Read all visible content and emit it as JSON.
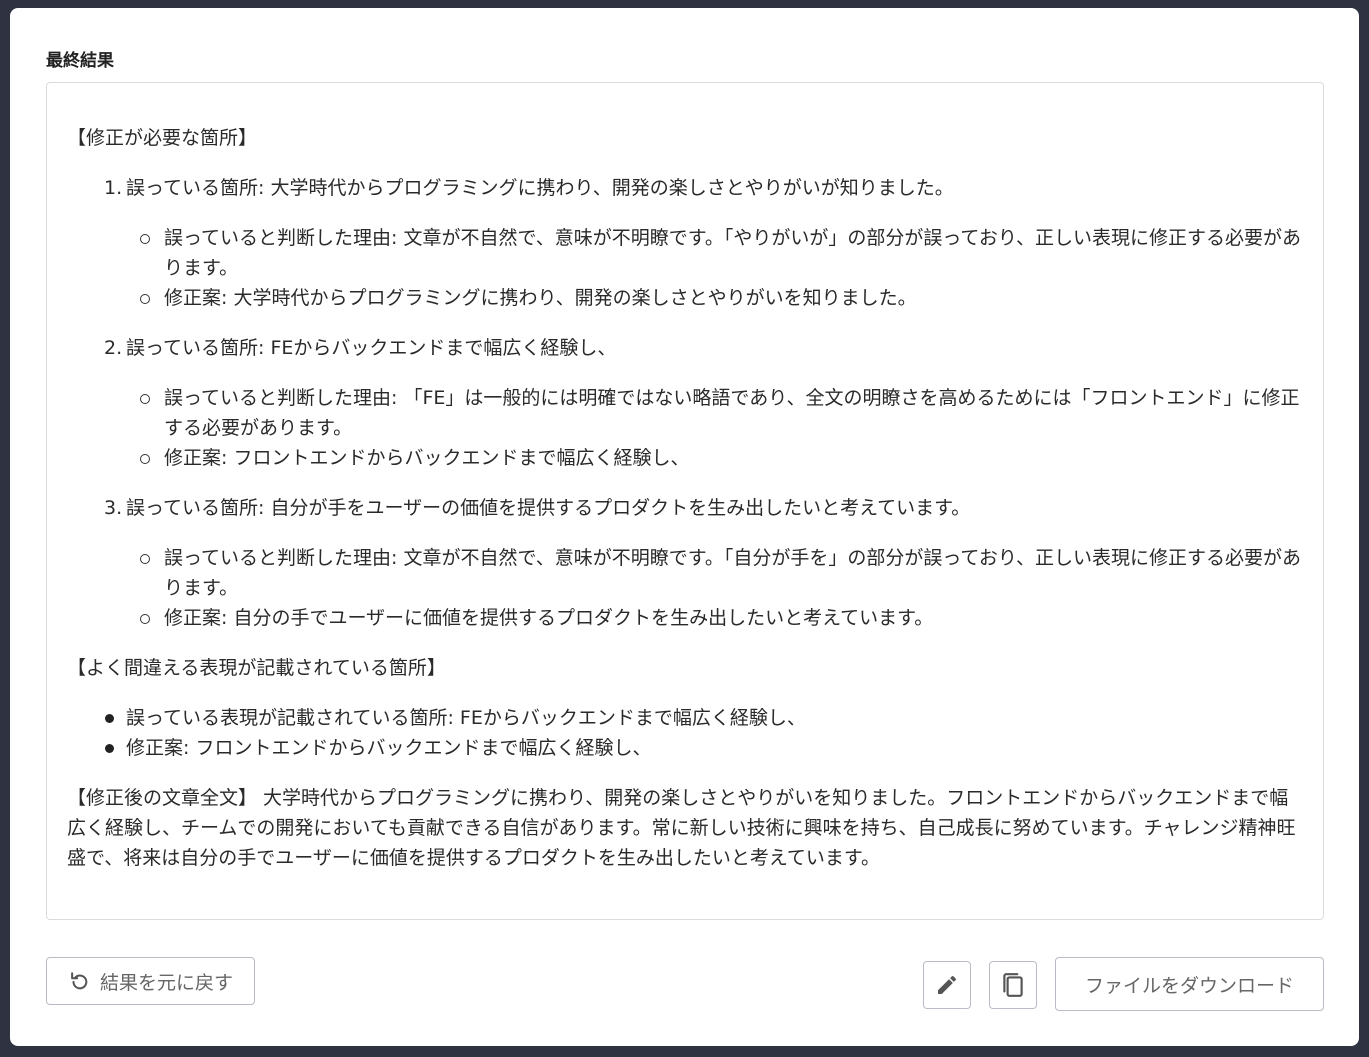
{
  "section_title": "最終結果",
  "result": {
    "corrections_heading": "【修正が必要な箇所】",
    "corrections": [
      {
        "number": "1.",
        "location": "誤っている箇所: 大学時代からプログラミングに携わり、開発の楽しさとやりがいが知りました。",
        "reason": "誤っていると判断した理由: 文章が不自然で、意味が不明瞭です。「やりがいが」の部分が誤っており、正しい表現に修正する必要があります。",
        "suggestion": "修正案: 大学時代からプログラミングに携わり、開発の楽しさとやりがいを知りました。"
      },
      {
        "number": "2.",
        "location": "誤っている箇所: FEからバックエンドまで幅広く経験し、",
        "reason": "誤っていると判断した理由: 「FE」は一般的には明確ではない略語であり、全文の明瞭さを高めるためには「フロントエンド」に修正する必要があります。",
        "suggestion": "修正案: フロントエンドからバックエンドまで幅広く経験し、"
      },
      {
        "number": "3.",
        "location": "誤っている箇所: 自分が手をユーザーの価値を提供するプロダクトを生み出したいと考えています。",
        "reason": "誤っていると判断した理由: 文章が不自然で、意味が不明瞭です。「自分が手を」の部分が誤っており、正しい表現に修正する必要があります。",
        "suggestion": "修正案: 自分の手でユーザーに価値を提供するプロダクトを生み出したいと考えています。"
      }
    ],
    "common_heading": "【よく間違える表現が記載されている箇所】",
    "common_items": [
      "誤っている表現が記載されている箇所: FEからバックエンドまで幅広く経験し、",
      "修正案: フロントエンドからバックエンドまで幅広く経験し、"
    ],
    "full_text": "【修正後の文章全文】 大学時代からプログラミングに携わり、開発の楽しさとやりがいを知りました。フロントエンドからバックエンドまで幅広く経験し、チームでの開発においても貢献できる自信があります。常に新しい技術に興味を持ち、自己成長に努めています。チャレンジ精神旺盛で、将来は自分の手でユーザーに価値を提供するプロダクトを生み出したいと考えています。"
  },
  "buttons": {
    "revert_label": "結果を元に戻す",
    "revert_icon": "undo-icon",
    "edit_icon": "pencil-icon",
    "copy_icon": "copy-icon",
    "download_label": "ファイルをダウンロード"
  }
}
